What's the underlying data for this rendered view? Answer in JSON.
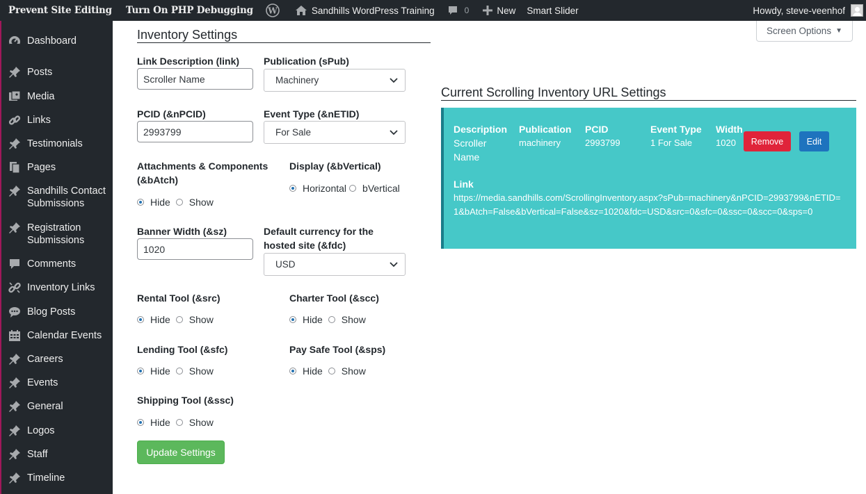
{
  "adminbar": {
    "prevent_editing": "Prevent Site Editing",
    "php_debug": "Turn On PHP Debugging",
    "site_name": "Sandhills WordPress Training",
    "comments_count": "0",
    "new_label": "New",
    "smart_slider": "Smart Slider",
    "howdy": "Howdy, steve-veenhof"
  },
  "sidebar": {
    "items": [
      {
        "label": "Dashboard",
        "icon": "dashboard-icon"
      },
      {
        "label": "Posts",
        "icon": "pin-icon"
      },
      {
        "label": "Media",
        "icon": "media-icon"
      },
      {
        "label": "Links",
        "icon": "link-icon"
      },
      {
        "label": "Testimonials",
        "icon": "pin-icon"
      },
      {
        "label": "Pages",
        "icon": "pages-icon"
      },
      {
        "label": "Sandhills Contact Submissions",
        "icon": "pin-icon"
      },
      {
        "label": "Registration Submissions",
        "icon": "pin-icon"
      },
      {
        "label": "Comments",
        "icon": "comments-icon"
      },
      {
        "label": "Inventory Links",
        "icon": "unlink-icon"
      },
      {
        "label": "Blog Posts",
        "icon": "chat-icon"
      },
      {
        "label": "Calendar Events",
        "icon": "calendar-icon"
      },
      {
        "label": "Careers",
        "icon": "pin-icon"
      },
      {
        "label": "Events",
        "icon": "pin-icon"
      },
      {
        "label": "General",
        "icon": "pin-icon"
      },
      {
        "label": "Logos",
        "icon": "pin-icon"
      },
      {
        "label": "Staff",
        "icon": "pin-icon"
      },
      {
        "label": "Timeline",
        "icon": "pin-icon"
      }
    ]
  },
  "screen_options": "Screen Options",
  "form": {
    "title": "Inventory Settings",
    "link_label": "Link Description (link)",
    "link_value": "Scroller Name",
    "pub_label": "Publication (sPub)",
    "pub_value": "Machinery",
    "pcid_label": "PCID (&nPCID)",
    "pcid_value": "2993799",
    "etid_label": "Event Type (&nETID)",
    "etid_value": "For Sale",
    "atch_label_1": "Attachments & Components",
    "atch_label_2": "(&bAtch)",
    "display_label": "Display (&bVertical)",
    "horizontal": "Horizontal",
    "vertical": "bVertical",
    "hide": "Hide",
    "show": "Show",
    "sz_label": "Banner Width (&sz)",
    "sz_value": "1020",
    "fdc_label_1": "Default currency for the",
    "fdc_label_2": "hosted site (&fdc)",
    "fdc_value": "USD",
    "src_label": "Rental Tool (&src)",
    "scc_label": "Charter Tool (&scc)",
    "sfc_label": "Lending Tool (&sfc)",
    "sps_label": "Pay Safe Tool (&sps)",
    "ssc_label": "Shipping Tool (&ssc)",
    "update_button": "Update Settings"
  },
  "current": {
    "title": "Current Scrolling Inventory URL Settings",
    "headers": {
      "description": "Description",
      "publication": "Publication",
      "pcid": "PCID",
      "event_type": "Event Type",
      "width": "Width"
    },
    "values": {
      "description_1": "Scroller",
      "description_2": "Name",
      "publication": "machinery",
      "pcid": "2993799",
      "event_type": "1 For Sale",
      "width": "1020"
    },
    "remove_button": "Remove",
    "edit_button": "Edit",
    "link_label": "Link",
    "link_value": "https://media.sandhills.com/ScrollingInventory.aspx?sPub=machinery&nPCID=2993799&nETID=1&bAtch=False&bVertical=False&sz=1020&fdc=USD&src=0&sfc=0&ssc=0&scc=0&sps=0"
  }
}
